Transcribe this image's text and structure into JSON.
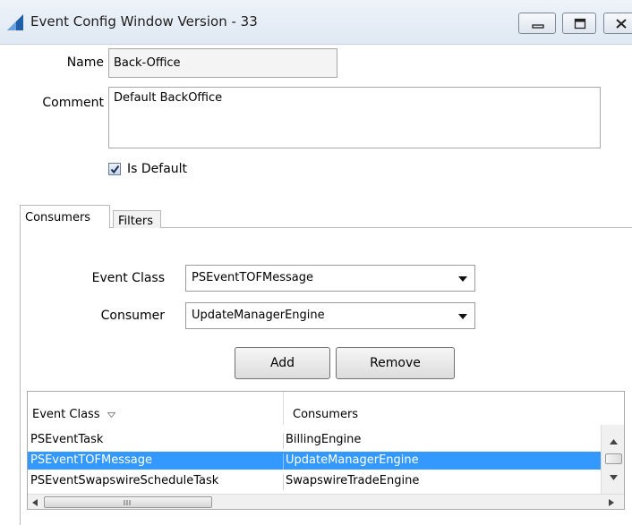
{
  "window": {
    "title": "Event Config Window  Version - 33"
  },
  "form": {
    "name_label": "Name",
    "name_value": "Back-Office",
    "comment_label": "Comment",
    "comment_value": "Default BackOffice",
    "is_default_label": "Is Default",
    "is_default_checked": true
  },
  "tabs": [
    {
      "label": "Consumers",
      "active": true
    },
    {
      "label": "Filters",
      "active": false
    }
  ],
  "consumers": {
    "event_class_label": "Event Class",
    "event_class_value": "PSEventTOFMessage",
    "consumer_label": "Consumer",
    "consumer_value": "UpdateManagerEngine",
    "add_label": "Add",
    "remove_label": "Remove",
    "table": {
      "columns": [
        "Event Class",
        "Consumers"
      ],
      "rows": [
        {
          "event_class": "PSEventTask",
          "consumer": "BillingEngine",
          "selected": false
        },
        {
          "event_class": "PSEventTOFMessage",
          "consumer": "UpdateManagerEngine",
          "selected": true
        },
        {
          "event_class": "PSEventSwapswireScheduleTask",
          "consumer": "SwapswireTradeEngine",
          "selected": false
        }
      ]
    }
  },
  "icons": [
    "app-icon",
    "minimize-icon",
    "maximize-icon",
    "close-icon",
    "checkmark-icon",
    "sort-icon",
    "dropdown-arrow-icon",
    "scroll-up-icon",
    "scroll-down-icon",
    "scroll-left-icon",
    "scroll-right-icon"
  ]
}
